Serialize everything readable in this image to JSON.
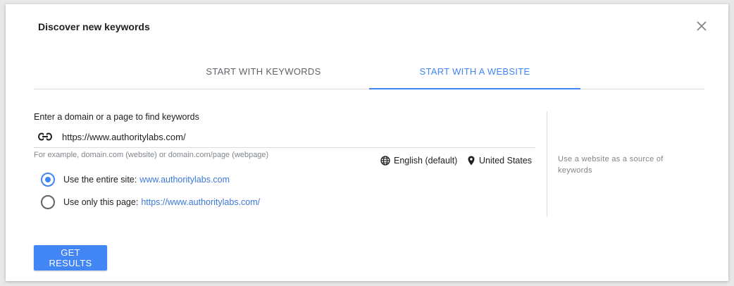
{
  "dialog": {
    "title": "Discover new keywords",
    "close_icon": "close-icon"
  },
  "tabs": [
    {
      "label": "START WITH KEYWORDS",
      "active": false
    },
    {
      "label": "START WITH A WEBSITE",
      "active": true
    }
  ],
  "form": {
    "field_label": "Enter a domain or a page to find keywords",
    "url_value": "https://www.authoritylabs.com/",
    "url_icon": "link-icon",
    "hint": "For example, domain.com (website) or domain.com/page (webpage)",
    "language": "English (default)",
    "language_icon": "globe-icon",
    "location": "United States",
    "location_icon": "location-pin-icon",
    "options": [
      {
        "label": "Use the entire site:",
        "link": "www.authoritylabs.com",
        "selected": true
      },
      {
        "label": "Use only this page:",
        "link": "https://www.authoritylabs.com/",
        "selected": false
      }
    ]
  },
  "side_help": "Use a website as a source of keywords",
  "actions": {
    "get_results_label": "GET RESULTS"
  },
  "colors": {
    "accent": "#4285f4",
    "link": "#3c78d8",
    "muted": "#80868b"
  }
}
